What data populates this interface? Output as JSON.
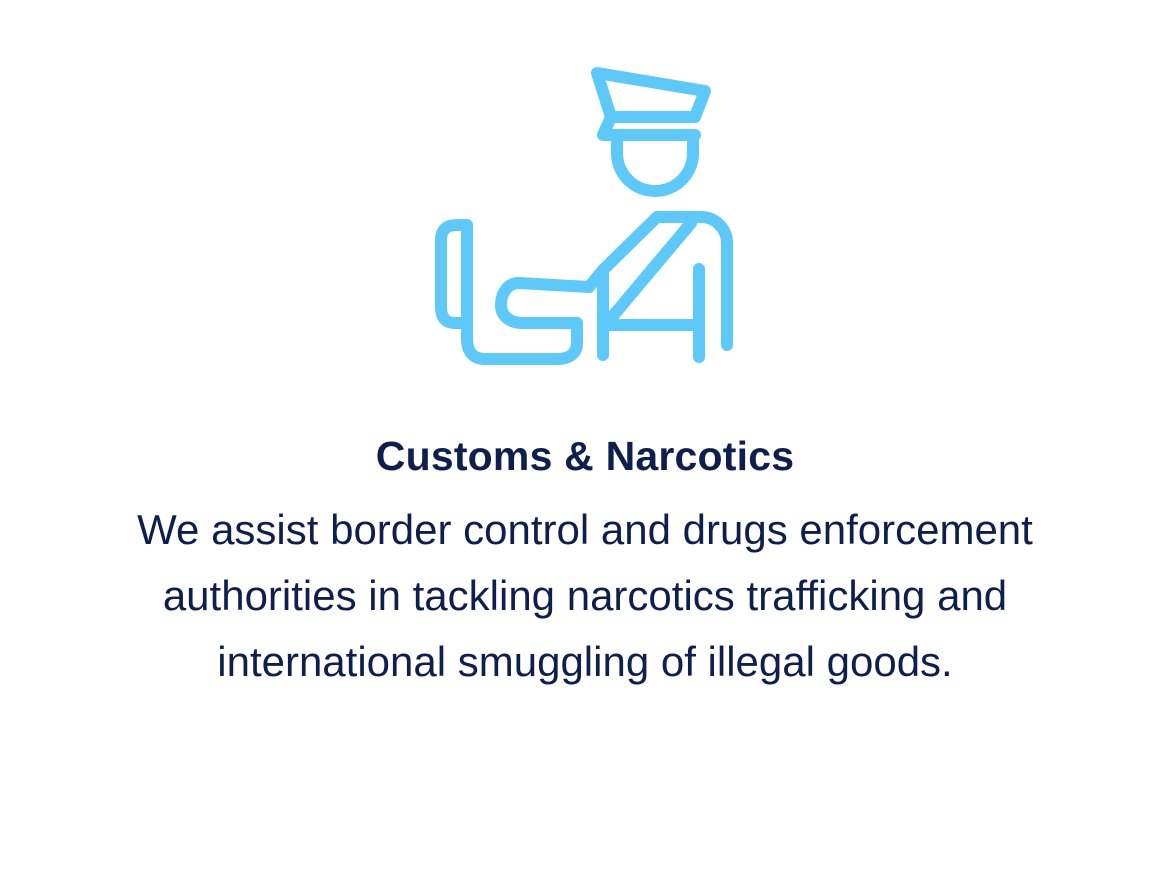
{
  "card": {
    "icon": "customs-officer-icon",
    "title": "Customs & Narcotics",
    "description": "We assist border control and drugs enforcement authorities in tackling narcotics trafficking and international smuggling of illegal goods."
  },
  "colors": {
    "icon_stroke": "#5ec8f8",
    "text": "#0e1f4d",
    "background": "#ffffff"
  }
}
